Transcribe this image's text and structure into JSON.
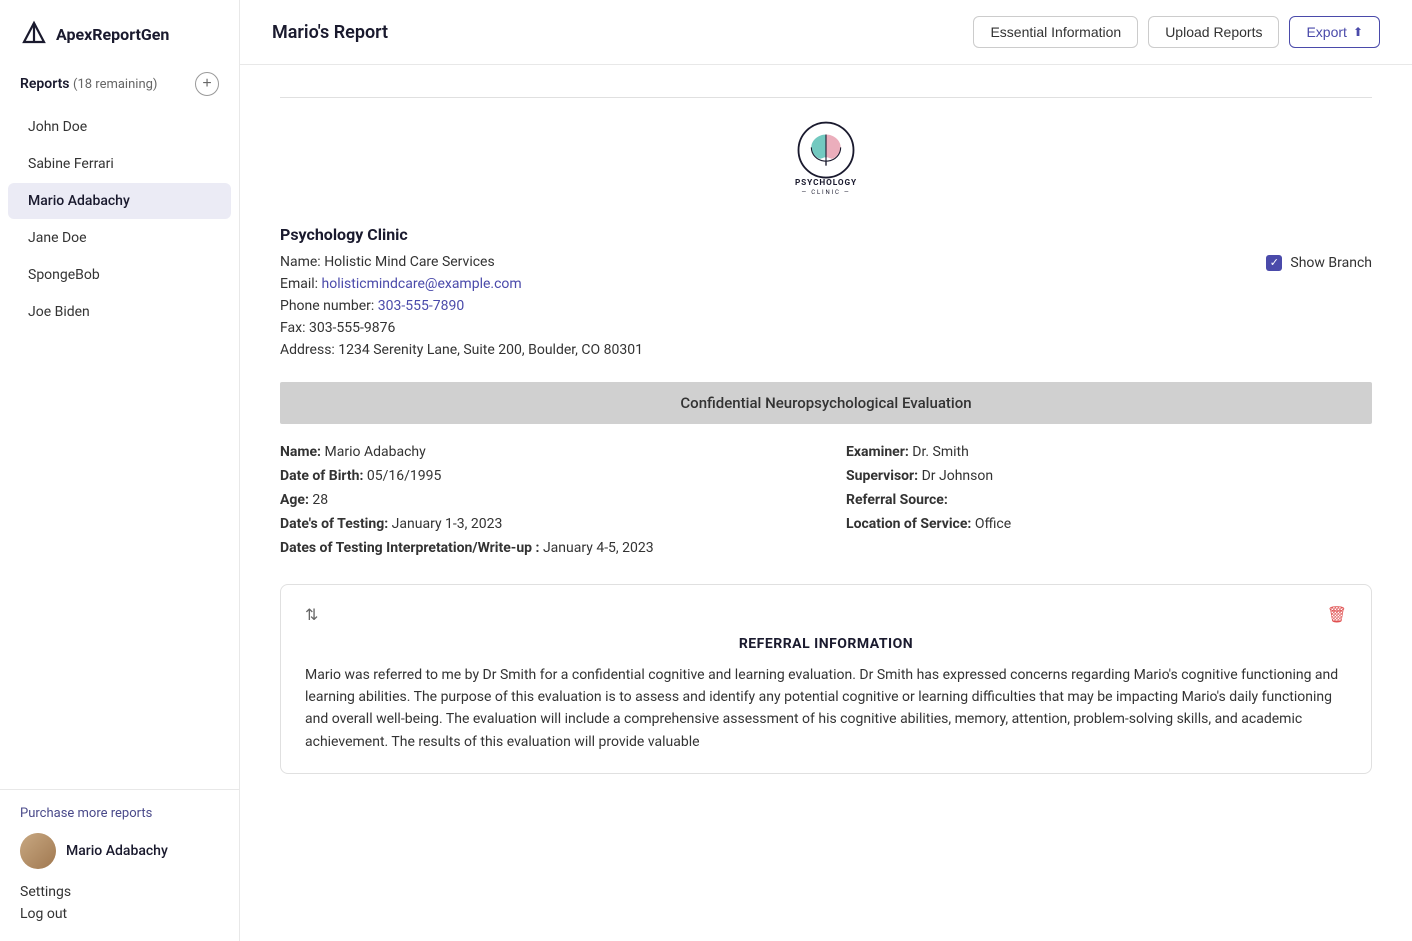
{
  "app": {
    "name": "ApexReportGen"
  },
  "sidebar": {
    "section_title": "Reports",
    "remaining": "(18 remaining)",
    "items": [
      {
        "label": "John Doe",
        "active": false
      },
      {
        "label": "Sabine Ferrari",
        "active": false
      },
      {
        "label": "Mario Adabachy",
        "active": true
      },
      {
        "label": "Jane Doe",
        "active": false
      },
      {
        "label": "SpongeBob",
        "active": false
      },
      {
        "label": "Joe Biden",
        "active": false
      }
    ],
    "purchase_link": "Purchase more reports",
    "user_name": "Mario Adabachy",
    "settings_link": "Settings",
    "logout_link": "Log out"
  },
  "topbar": {
    "title": "Mario's Report",
    "essential_info_btn": "Essential Information",
    "upload_reports_btn": "Upload Reports",
    "export_btn": "Export"
  },
  "clinic": {
    "section_title": "Psychology Clinic",
    "name_label": "Name:",
    "name_value": "Holistic Mind Care Services",
    "email_label": "Email:",
    "email_value": "holisticmindcare@example.com",
    "phone_label": "Phone number:",
    "phone_value": "303-555-7890",
    "fax_label": "Fax:",
    "fax_value": "303-555-9876",
    "address_label": "Address:",
    "address_value": "1234 Serenity Lane, Suite 200, Boulder, CO 80301",
    "show_branch_label": "Show Branch",
    "show_branch_checked": true
  },
  "evaluation": {
    "header": "Confidential Neuropsychological Evaluation",
    "name_label": "Name:",
    "name_value": "Mario Adabachy",
    "dob_label": "Date of Birth:",
    "dob_value": "05/16/1995",
    "age_label": "Age:",
    "age_value": "28",
    "testing_dates_label": "Date's of Testing:",
    "testing_dates_value": "January 1-3, 2023",
    "interp_dates_label": "Dates of Testing Interpretation/Write-up :",
    "interp_dates_value": "January 4-5, 2023",
    "examiner_label": "Examiner:",
    "examiner_value": "Dr. Smith",
    "supervisor_label": "Supervisor:",
    "supervisor_value": "Dr Johnson",
    "referral_source_label": "Referral Source:",
    "referral_source_value": "",
    "location_label": "Location of Service:",
    "location_value": "Office"
  },
  "referral_section": {
    "title": "REFERRAL INFORMATION",
    "body": "Mario was referred to me by Dr Smith for a confidential cognitive and learning evaluation. Dr Smith has expressed concerns regarding Mario's cognitive functioning and learning abilities. The purpose of this evaluation is to assess and identify any potential cognitive or learning difficulties that may be impacting Mario's daily functioning and overall well-being. The evaluation will include a comprehensive assessment of his cognitive abilities, memory, attention, problem-solving skills, and academic achievement. The results of this evaluation will provide valuable"
  }
}
